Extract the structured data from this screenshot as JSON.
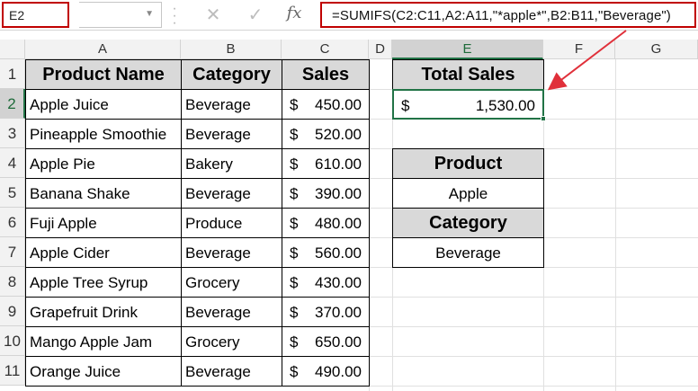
{
  "name_box": "E2",
  "formula": "=SUMIFS(C2:C11,A2:A11,\"*apple*\",B2:B11,\"Beverage\")",
  "toolbar_icons": [
    "cancel-icon",
    "enter-icon",
    "insert-function-icon"
  ],
  "fx_label": "fx",
  "columns": [
    "A",
    "B",
    "C",
    "D",
    "E",
    "F",
    "G"
  ],
  "rows": [
    "1",
    "2",
    "3",
    "4",
    "5",
    "6",
    "7",
    "8",
    "9",
    "10",
    "11"
  ],
  "table": {
    "headers": [
      "Product Name",
      "Category",
      "Sales"
    ],
    "rows": [
      {
        "product": "Apple Juice",
        "category": "Beverage",
        "currency": "$",
        "sales": "450.00"
      },
      {
        "product": "Pineapple Smoothie",
        "category": "Beverage",
        "currency": "$",
        "sales": "520.00"
      },
      {
        "product": "Apple Pie",
        "category": "Bakery",
        "currency": "$",
        "sales": "610.00"
      },
      {
        "product": "Banana Shake",
        "category": "Beverage",
        "currency": "$",
        "sales": "390.00"
      },
      {
        "product": "Fuji Apple",
        "category": "Produce",
        "currency": "$",
        "sales": "480.00"
      },
      {
        "product": "Apple Cider",
        "category": "Beverage",
        "currency": "$",
        "sales": "560.00"
      },
      {
        "product": "Apple Tree Syrup",
        "category": "Grocery",
        "currency": "$",
        "sales": "430.00"
      },
      {
        "product": "Grapefruit Drink",
        "category": "Beverage",
        "currency": "$",
        "sales": "370.00"
      },
      {
        "product": "Mango Apple Jam",
        "category": "Grocery",
        "currency": "$",
        "sales": "650.00"
      },
      {
        "product": "Orange Juice",
        "category": "Beverage",
        "currency": "$",
        "sales": "490.00"
      }
    ]
  },
  "summary": {
    "total_label": "Total Sales",
    "total_currency": "$",
    "total_value": "1,530.00",
    "product_label": "Product",
    "product_value": "Apple",
    "category_label": "Category",
    "category_value": "Beverage"
  },
  "colors": {
    "highlight_border": "#c00000",
    "selection": "#217346",
    "header_fill": "#d9d9d9",
    "arrow": "#e0303a"
  }
}
